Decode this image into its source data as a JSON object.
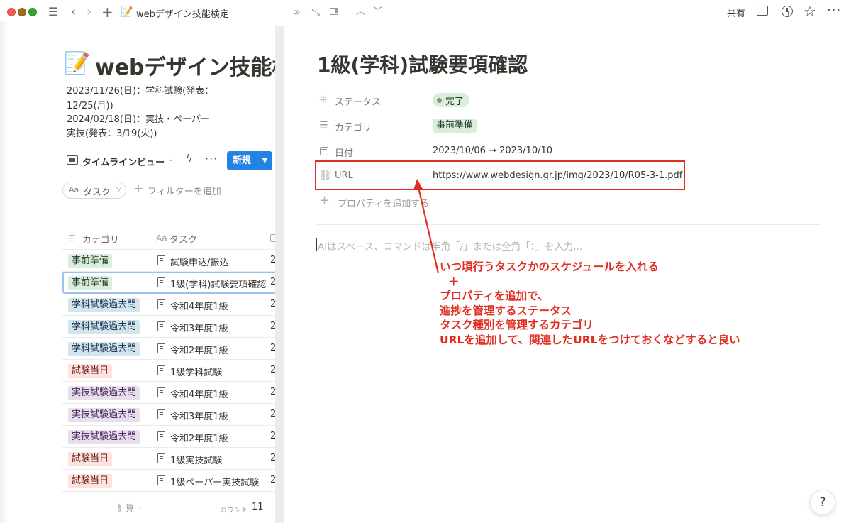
{
  "topbar": {
    "page_icon": "📝",
    "page_title": "webデザイン技能検定",
    "share_label": "共有"
  },
  "left_page": {
    "emoji": "📝",
    "title": "webデザイン技能検定",
    "description": [
      "2023/11/26(日)：学科試験(発表：",
      "12/25(月))",
      "2024/02/18(日)：実技・ペーパー",
      "実技(発表：3/19(火))"
    ],
    "view_label": "タイムラインビュー",
    "new_button_label": "新規",
    "filter_chip": {
      "prefix": "Aa",
      "label": "タスク"
    },
    "add_filter_label": "フィルターを追加",
    "table": {
      "header_category": "カテゴリ",
      "header_task_prefix": "Aa",
      "header_task": "タスク",
      "rows": [
        {
          "category": "事前準備",
          "task": "試験申込/振込",
          "date": "2",
          "tag": "prep"
        },
        {
          "category": "事前準備",
          "task": "1級(学科)試験要項確認",
          "date": "2",
          "tag": "prep",
          "selected": true
        },
        {
          "category": "学科試験過去問",
          "task": "令和4年度1級",
          "date": "2",
          "tag": "gakka"
        },
        {
          "category": "学科試験過去問",
          "task": "令和3年度1級",
          "date": "2",
          "tag": "gakka"
        },
        {
          "category": "学科試験過去問",
          "task": "令和2年度1級",
          "date": "2",
          "tag": "gakka"
        },
        {
          "category": "試験当日",
          "task": "1級学科試験",
          "date": "2",
          "tag": "day"
        },
        {
          "category": "実技試験過去問",
          "task": "令和4年度1級",
          "date": "2",
          "tag": "jitsugi"
        },
        {
          "category": "実技試験過去問",
          "task": "令和3年度1級",
          "date": "2",
          "tag": "jitsugi"
        },
        {
          "category": "実技試験過去問",
          "task": "令和2年度1級",
          "date": "2",
          "tag": "jitsugi"
        },
        {
          "category": "試験当日",
          "task": "1級実技試験",
          "date": "2",
          "tag": "day"
        },
        {
          "category": "試験当日",
          "task": "1級ペーパー実技試験",
          "date": "2",
          "tag": "day"
        }
      ]
    },
    "footer": {
      "calc_label": "計算",
      "count_label": "カウント",
      "count_value": "11"
    }
  },
  "detail": {
    "title": "1級(学科)試験要項確認",
    "properties": {
      "status": {
        "label": "ステータス",
        "value": "完了"
      },
      "category": {
        "label": "カテゴリ",
        "value": "事前準備"
      },
      "date": {
        "label": "日付",
        "value": "2023/10/06 → 2023/10/10"
      },
      "url": {
        "label": "URL",
        "value": "https://www.webdesign.gr.jp/img/2023/10/R05-3-1.pdf"
      },
      "add_label": "プロパティを追加する"
    },
    "editor_placeholder": "AIはスペース、コマンドは半角「/」または全角「；」を入力..."
  },
  "annotation": {
    "lines": [
      "いつ頃行うタスクかのスケジュールを入れる",
      "＋",
      "プロパティを追加で、",
      "進捗を管理するステータス",
      "タスク種別を管理するカテゴリ",
      "URLを追加して、関連したURLをつけておくなどすると良い"
    ],
    "color": "#e02d1f"
  },
  "help_label": "?",
  "colors": {
    "accent": "#2383e2",
    "tag_prep_bg": "#dbeddb",
    "tag_gakka_bg": "#d3e5ef",
    "tag_day_bg": "#ffe2dd",
    "tag_jitsugi_bg": "#e8deee"
  },
  "icons": {
    "status": "spinner-icon",
    "category": "list-icon",
    "date": "calendar-icon",
    "url": "link-icon",
    "add": "plus-icon"
  }
}
